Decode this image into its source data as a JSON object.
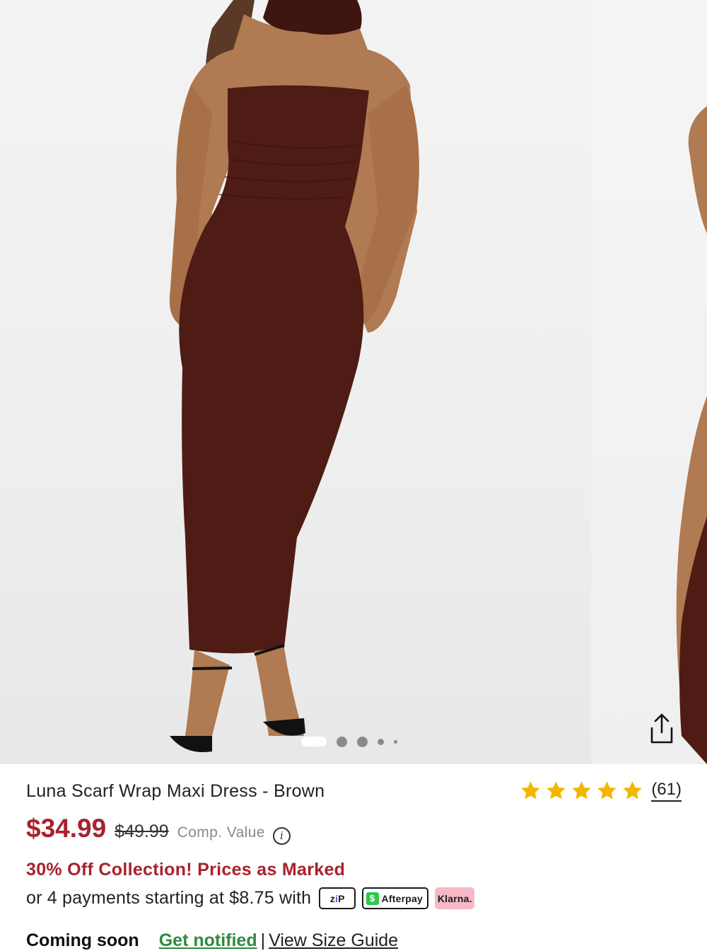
{
  "gallery": {
    "image_alt": "Model wearing brown strapless scarf wrap maxi dress with black strappy heels",
    "dot_count": 5,
    "active_dot": 1
  },
  "product": {
    "title": "Luna Scarf Wrap Maxi Dress - Brown",
    "rating": 5,
    "review_count": "(61)",
    "price": "$34.99",
    "original_price": "$49.99",
    "comp_label": "Comp. Value",
    "promo": "30% Off Collection! Prices as Marked",
    "installments": "or 4 payments starting at $8.75 with",
    "availability": "Coming soon",
    "notify_label": "Get notified",
    "size_guide_label": "View Size Guide"
  },
  "payment_badges": {
    "zip_z": "z",
    "zip_i": "i",
    "zip_p": "P",
    "afterpay_label": "Afterpay",
    "afterpay_symbol": "$",
    "klarna_label": "Klarna."
  },
  "icons": {
    "share": "share-icon",
    "info": "info-icon",
    "star": "star-icon"
  },
  "colors": {
    "sale_red": "#a8222d",
    "notify_green": "#2e8b3e",
    "star_gold": "#f2b600",
    "dress_brown": "#4e1c14",
    "klarna_pink": "#f6b8c7",
    "afterpay_green": "#2cc84a",
    "zip_purple": "#6b46e5"
  }
}
